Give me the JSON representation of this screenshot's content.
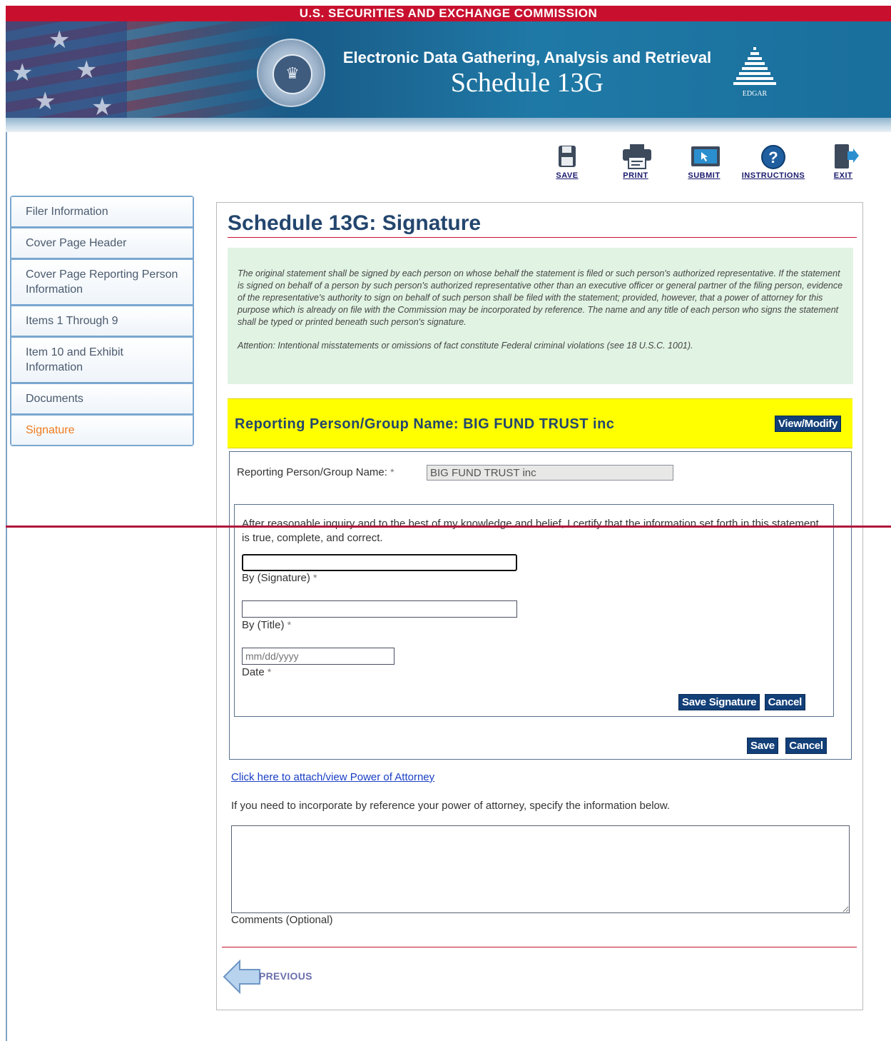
{
  "banner": {
    "agency": "U.S. SECURITIES AND EXCHANGE COMMISSION",
    "system_title": "Electronic Data Gathering, Analysis and Retrieval",
    "form_title": "Schedule 13G",
    "logo_text": "EDGAR"
  },
  "toolbar": {
    "save": "SAVE",
    "print": "PRINT",
    "submit": "SUBMIT",
    "instructions": "INSTRUCTIONS",
    "exit": "EXIT"
  },
  "sidebar": {
    "items": [
      {
        "label": "Filer Information",
        "active": false
      },
      {
        "label": "Cover Page Header",
        "active": false
      },
      {
        "label": "Cover Page Reporting Person Information",
        "active": false
      },
      {
        "label": "Items 1 Through 9",
        "active": false
      },
      {
        "label": "Item 10 and Exhibit Information",
        "active": false
      },
      {
        "label": "Documents",
        "active": false
      },
      {
        "label": "Signature",
        "active": true
      }
    ]
  },
  "main": {
    "title": "Schedule 13G: Signature",
    "notice_paragraph": "The original statement shall be signed by each person on whose behalf the statement is filed or such person's authorized representative. If the statement is signed on behalf of a person by such person's authorized representative other than an executive officer or general partner of the filing person, evidence of the representative's authority to sign on behalf of such person shall be filed with the statement; provided, however, that a power of attorney for this purpose which is already on file with the Commission may be incorporated by reference. The name and any title of each person who signs the statement shall be typed or printed beneath such person's signature.",
    "notice_attention": "Attention: Intentional misstatements or omissions of fact constitute Federal criminal violations (see 18 U.S.C. 1001).",
    "reporting_header": "Reporting Person/Group Name: BIG FUND TRUST inc",
    "view_modify": "View/Modify",
    "rp_label": "Reporting Person/Group Name:",
    "rp_value": "BIG FUND TRUST inc",
    "required_mark": "*",
    "certify": "After reasonable inquiry and to the best of my knowledge and belief, I certify that the information set forth in this statement is true, complete, and correct.",
    "signature_label": "By (Signature)",
    "signature_value": "",
    "title_label": "By (Title)",
    "title_value": "",
    "date_placeholder": "mm/dd/yyyy",
    "date_label": "Date",
    "save_signature": "Save Signature",
    "cancel": "Cancel",
    "save": "Save",
    "poa_link": "Click here to attach/view Power of Attorney",
    "poa_text": "If you need to incorporate by reference your power of attorney, specify the information below.",
    "comments_value": "",
    "comments_label": "Comments (Optional)",
    "previous": "PREVIOUS"
  },
  "colors": {
    "accent_red": "#c8102e",
    "nav_blue": "#123f78",
    "highlight_yellow": "#ffff00",
    "notice_green": "#e1f3e3",
    "active_nav": "#f07b1f"
  }
}
